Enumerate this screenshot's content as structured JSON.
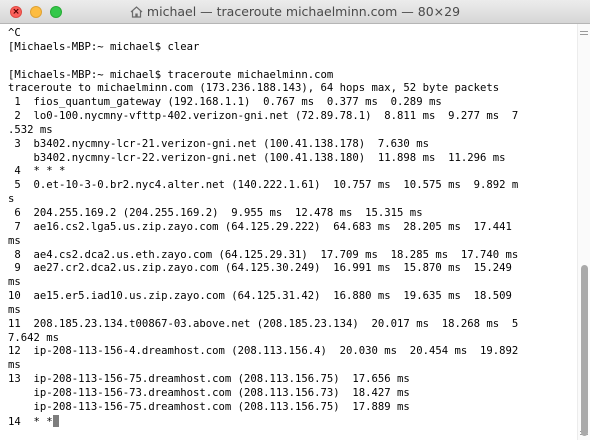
{
  "window": {
    "title": "michael — traceroute michaelminn.com — 80×29"
  },
  "terminal": {
    "lines": [
      "^C",
      "[Michaels-MBP:~ michael$ clear",
      "",
      "[Michaels-MBP:~ michael$ traceroute michaelminn.com",
      "traceroute to michaelminn.com (173.236.188.143), 64 hops max, 52 byte packets",
      " 1  fios_quantum_gateway (192.168.1.1)  0.767 ms  0.377 ms  0.289 ms",
      " 2  lo0-100.nycmny-vfttp-402.verizon-gni.net (72.89.78.1)  8.811 ms  9.277 ms  7",
      ".532 ms",
      " 3  b3402.nycmny-lcr-21.verizon-gni.net (100.41.138.178)  7.630 ms",
      "    b3402.nycmny-lcr-22.verizon-gni.net (100.41.138.180)  11.898 ms  11.296 ms",
      " 4  * * *",
      " 5  0.et-10-3-0.br2.nyc4.alter.net (140.222.1.61)  10.757 ms  10.575 ms  9.892 m",
      "s",
      " 6  204.255.169.2 (204.255.169.2)  9.955 ms  12.478 ms  15.315 ms",
      " 7  ae16.cs2.lga5.us.zip.zayo.com (64.125.29.222)  64.683 ms  28.205 ms  17.441",
      "ms",
      " 8  ae4.cs2.dca2.us.eth.zayo.com (64.125.29.31)  17.709 ms  18.285 ms  17.740 ms",
      " 9  ae27.cr2.dca2.us.zip.zayo.com (64.125.30.249)  16.991 ms  15.870 ms  15.249",
      "ms",
      "10  ae15.er5.iad10.us.zip.zayo.com (64.125.31.42)  16.880 ms  19.635 ms  18.509",
      "ms",
      "11  208.185.23.134.t00867-03.above.net (208.185.23.134)  20.017 ms  18.268 ms  5",
      "7.642 ms",
      "12  ip-208-113-156-4.dreamhost.com (208.113.156.4)  20.030 ms  20.454 ms  19.892",
      "ms",
      "13  ip-208-113-156-75.dreamhost.com (208.113.156.75)  17.656 ms",
      "    ip-208-113-156-73.dreamhost.com (208.113.156.73)  18.427 ms",
      "    ip-208-113-156-75.dreamhost.com (208.113.156.75)  17.889 ms",
      "14  * *"
    ]
  },
  "scrollbar": {
    "position": 0.58,
    "visible_fraction": 0.42
  }
}
